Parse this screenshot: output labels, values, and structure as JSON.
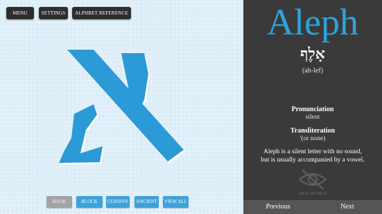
{
  "top_buttons": {
    "menu": "MENU",
    "settings": "SETTINGS",
    "alphabet_reference": "ALPHBET REFERENCE"
  },
  "style_buttons": {
    "book": "BOOK",
    "block": "BLOCK",
    "cursive": "CURSIVE",
    "ancient": "ANCIENT",
    "view_all": "VIEW ALL"
  },
  "letter": {
    "name": "Aleph",
    "hebrew": "אָלֶף",
    "phonetic": "(ah-lef)",
    "pronunciation_label": "Pronunciation",
    "pronunciation_value": "silent",
    "transliteration_label": "Transliteration",
    "transliteration_value": "'(or none)",
    "description_line1": "Aleph is a silent letter with no sound,",
    "description_line2": "but is usually accompanied by a vowel."
  },
  "hide_details": "HIDE DETAILS",
  "nav": {
    "previous": "Previous",
    "next": "Next"
  },
  "colors": {
    "accent": "#2ea3db",
    "letter_glyph": "#2b9ad6",
    "panel_bg": "#3a3a3a",
    "canvas_bg": "#ddeef8"
  },
  "icons": {
    "hide_details": "eye-slash-icon",
    "letter_glyph": "aleph-letter"
  }
}
